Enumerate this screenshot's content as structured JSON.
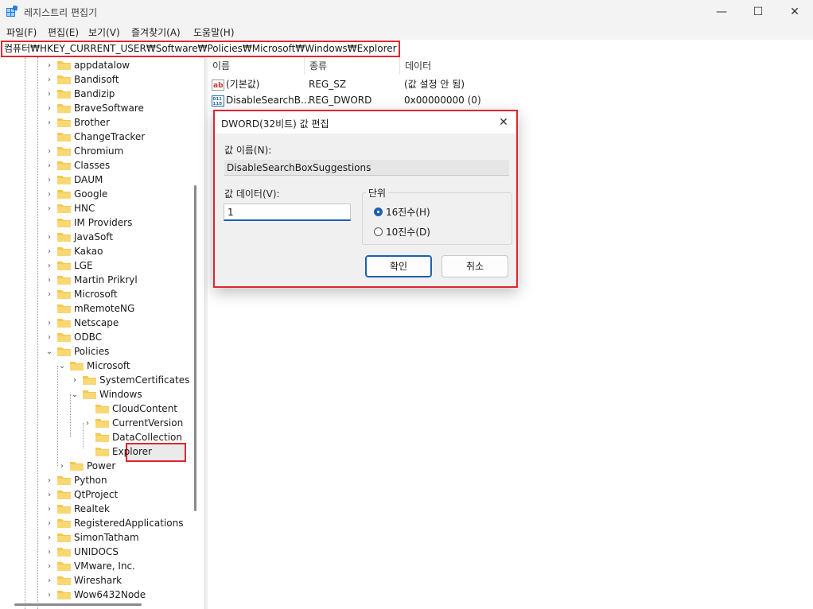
{
  "window": {
    "title": "레지스트리 편집기",
    "minimize": "—",
    "maximize": "☐",
    "close": "✕"
  },
  "menu": [
    "파일(F)",
    "편집(E)",
    "보기(V)",
    "즐겨찾기(A)",
    "도움말(H)"
  ],
  "address": "컴퓨터₩HKEY_CURRENT_USER₩Software₩Policies₩Microsoft₩Windows₩Explorer",
  "tree": [
    {
      "label": "appdatalow",
      "level": 0,
      "chev": "›"
    },
    {
      "label": "Bandisoft",
      "level": 0,
      "chev": "›"
    },
    {
      "label": "Bandizip",
      "level": 0,
      "chev": "›"
    },
    {
      "label": "BraveSoftware",
      "level": 0,
      "chev": "›"
    },
    {
      "label": "Brother",
      "level": 0,
      "chev": "›"
    },
    {
      "label": "ChangeTracker",
      "level": 0,
      "chev": ""
    },
    {
      "label": "Chromium",
      "level": 0,
      "chev": "›"
    },
    {
      "label": "Classes",
      "level": 0,
      "chev": "›"
    },
    {
      "label": "DAUM",
      "level": 0,
      "chev": "›"
    },
    {
      "label": "Google",
      "level": 0,
      "chev": "›"
    },
    {
      "label": "HNC",
      "level": 0,
      "chev": "›"
    },
    {
      "label": "IM Providers",
      "level": 0,
      "chev": ""
    },
    {
      "label": "JavaSoft",
      "level": 0,
      "chev": "›"
    },
    {
      "label": "Kakao",
      "level": 0,
      "chev": "›"
    },
    {
      "label": "LGE",
      "level": 0,
      "chev": "›"
    },
    {
      "label": "Martin Prikryl",
      "level": 0,
      "chev": "›"
    },
    {
      "label": "Microsoft",
      "level": 0,
      "chev": "›"
    },
    {
      "label": "mRemoteNG",
      "level": 0,
      "chev": ""
    },
    {
      "label": "Netscape",
      "level": 0,
      "chev": "›"
    },
    {
      "label": "ODBC",
      "level": 0,
      "chev": "›"
    },
    {
      "label": "Policies",
      "level": 0,
      "chev": "⌄"
    },
    {
      "label": "Microsoft",
      "level": 1,
      "chev": "⌄"
    },
    {
      "label": "SystemCertificates",
      "level": 2,
      "chev": "›"
    },
    {
      "label": "Windows",
      "level": 2,
      "chev": "⌄"
    },
    {
      "label": "CloudContent",
      "level": 3,
      "chev": ""
    },
    {
      "label": "CurrentVersion",
      "level": 3,
      "chev": "›"
    },
    {
      "label": "DataCollection",
      "level": 3,
      "chev": ""
    },
    {
      "label": "Explorer",
      "level": 3,
      "chev": "",
      "selected": true
    },
    {
      "label": "Power",
      "level": 1,
      "chev": "›"
    },
    {
      "label": "Python",
      "level": 0,
      "chev": "›"
    },
    {
      "label": "QtProject",
      "level": 0,
      "chev": "›"
    },
    {
      "label": "Realtek",
      "level": 0,
      "chev": "›"
    },
    {
      "label": "RegisteredApplications",
      "level": 0,
      "chev": "›"
    },
    {
      "label": "SimonTatham",
      "level": 0,
      "chev": "›"
    },
    {
      "label": "UNIDOCS",
      "level": 0,
      "chev": "›"
    },
    {
      "label": "VMware, Inc.",
      "level": 0,
      "chev": "›"
    },
    {
      "label": "Wireshark",
      "level": 0,
      "chev": "›"
    },
    {
      "label": "Wow6432Node",
      "level": 0,
      "chev": "›"
    }
  ],
  "list": {
    "headers": [
      "이름",
      "종류",
      "데이터"
    ],
    "rows": [
      {
        "name": "(기본값)",
        "type": "REG_SZ",
        "data": "(값 설정 안 됨)",
        "icon": "string-value-icon"
      },
      {
        "name": "DisableSearchB...",
        "type": "REG_DWORD",
        "data": "0x00000000 (0)",
        "icon": "dword-value-icon"
      }
    ]
  },
  "dialog": {
    "title": "DWORD(32비트) 값 편집",
    "close": "✕",
    "value_name_label": "값 이름(N):",
    "value_name": "DisableSearchBoxSuggestions",
    "value_data_label": "값 데이터(V):",
    "value_data": "1",
    "base_label": "단위",
    "hex_label": "16진수(H)",
    "dec_label": "10진수(D)",
    "ok_label": "확인",
    "cancel_label": "취소"
  },
  "colors": {
    "highlight": "#e0262f",
    "folder": "#f5c84c",
    "accent": "#1c60b0"
  }
}
